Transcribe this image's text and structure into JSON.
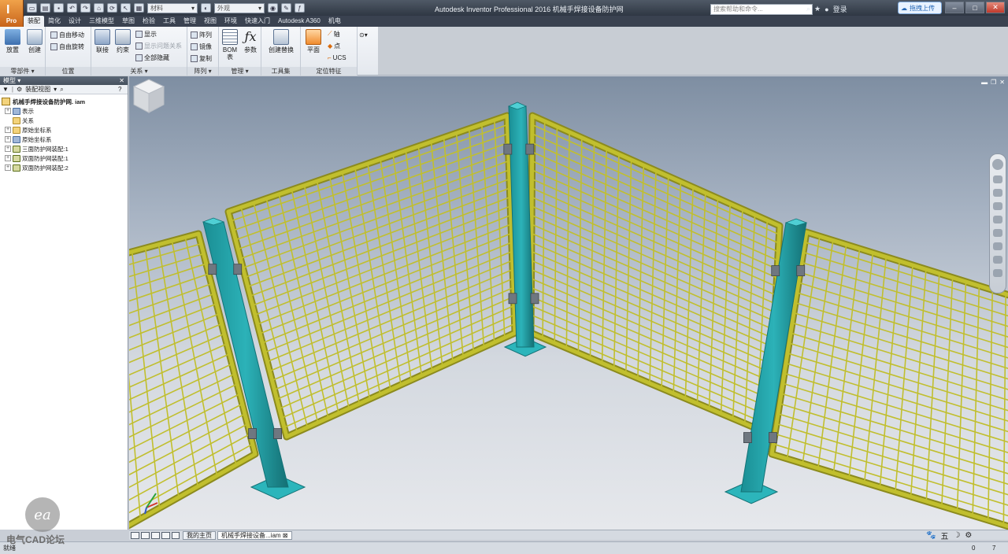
{
  "titlebar": {
    "app_version": "Pro",
    "qat_material": "材料",
    "qat_appearance": "外观",
    "title": "Autodesk Inventor Professional 2016    机械手焊接设备防护网",
    "help_search_placeholder": "搜索帮助和命令...",
    "signin": "登录",
    "upload": "拖拽上传"
  },
  "tabs": [
    "装配",
    "简化",
    "设计",
    "三维模型",
    "草图",
    "检验",
    "工具",
    "管理",
    "视图",
    "环境",
    "快速入门",
    "Autodesk A360",
    "机电"
  ],
  "active_tab": "装配",
  "ribbon": {
    "component": {
      "place": "放置",
      "create": "创建",
      "label": "零部件 ▾"
    },
    "position": {
      "free_move": "自由移动",
      "free_rotate": "自由旋转",
      "label": "位置"
    },
    "relationships": {
      "joint": "联接",
      "constrain": "约束",
      "show": "显示",
      "show_sick": "显示问题关系",
      "hide_all": "全部隐藏",
      "label": "关系 ▾"
    },
    "pattern": {
      "pattern": "阵列",
      "mirror": "镜像",
      "copy": "复制",
      "label": "阵列 ▾"
    },
    "manage": {
      "bom": "BOM 表",
      "params": "参数",
      "label": "管理 ▾"
    },
    "productivity": {
      "create_sub": "创建替换",
      "label": "工具集"
    },
    "work_features": {
      "plane": "平面",
      "axis": "轴",
      "point": "点",
      "ucs": "UCS",
      "label": "定位特征"
    }
  },
  "browser": {
    "title": "模型 ▾",
    "view_mode": "装配视图",
    "root": "机械手焊接设备防护网. iam",
    "items": [
      {
        "label": "表示",
        "icon": "representations-icon",
        "expandable": true
      },
      {
        "label": "关系",
        "icon": "folder-icon",
        "expandable": false
      },
      {
        "label": "原始坐标系",
        "icon": "folder-icon",
        "expandable": true
      },
      {
        "label": "原始坐标系",
        "icon": "origin-icon",
        "expandable": true
      },
      {
        "label": "三面防护网装配:1",
        "icon": "assembly-icon",
        "expandable": true
      },
      {
        "label": "双面防护网装配:1",
        "icon": "assembly-icon",
        "expandable": true
      },
      {
        "label": "双面防护网装配:2",
        "icon": "assembly-icon",
        "expandable": true
      }
    ]
  },
  "doc_tabs": {
    "home": "我的主页",
    "file": "机械手焊接设备...iam"
  },
  "tray": [
    "五",
    "☽",
    "⚙"
  ],
  "status": {
    "text": "就绪",
    "n1": "0",
    "n2": "7"
  },
  "watermark": {
    "logo": "ea",
    "text": "电气CAD论坛"
  },
  "colors": {
    "mesh": "#c1bf2e",
    "frame": "#8c8b1d",
    "post": "#1d9aa0",
    "post_dark": "#137276",
    "clamp": "#6f7780"
  }
}
